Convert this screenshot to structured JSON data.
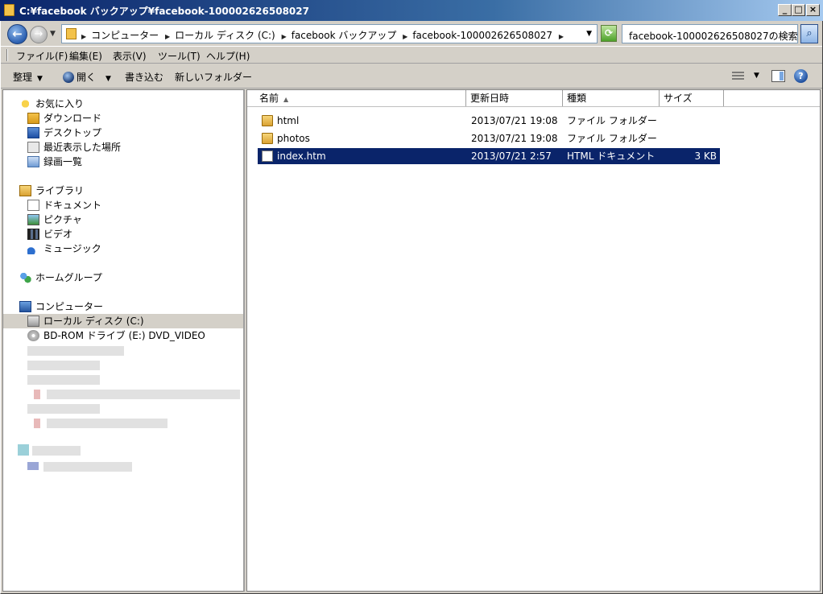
{
  "window": {
    "title": "C:¥facebook バックアップ¥facebook-100002626508027",
    "controls": [
      "_",
      "□",
      "×"
    ]
  },
  "nav": {
    "back_icon": "back-arrow-icon",
    "forward_icon": "forward-arrow-icon",
    "breadcrumbs": [
      "コンピューター",
      "ローカル ディスク (C:)",
      "facebook バックアップ",
      "facebook-100002626508027"
    ],
    "search_placeholder": "facebook-100002626508027の検索"
  },
  "menu": [
    "ファイル(F)",
    "編集(E)",
    "表示(V)",
    "ツール(T)",
    "ヘルプ(H)"
  ],
  "commands": {
    "organize": "整理",
    "open": "開く",
    "burn": "書き込む",
    "new_folder": "新しいフォルダー"
  },
  "sidebar": {
    "favorites": {
      "label": "お気に入り",
      "items": [
        "ダウンロード",
        "デスクトップ",
        "最近表示した場所",
        "録画一覧"
      ]
    },
    "libraries": {
      "label": "ライブラリ",
      "items": [
        "ドキュメント",
        "ピクチャ",
        "ビデオ",
        "ミュージック"
      ]
    },
    "homegroup": "ホームグループ",
    "computer": {
      "label": "コンピューター",
      "items": [
        "ローカル ディスク (C:)",
        "BD-ROM ドライブ (E:) DVD_VIDEO"
      ]
    }
  },
  "columns": [
    "名前",
    "更新日時",
    "種類",
    "サイズ"
  ],
  "files": [
    {
      "name": "html",
      "date": "2013/07/21 19:08",
      "type": "ファイル フォルダー",
      "size": "",
      "icon": "folder-icon"
    },
    {
      "name": "photos",
      "date": "2013/07/21 19:08",
      "type": "ファイル フォルダー",
      "size": "",
      "icon": "folder-icon"
    },
    {
      "name": "index.htm",
      "date": "2013/07/21 2:57",
      "type": "HTML ドキュメント",
      "size": "3 KB",
      "icon": "html-file-icon"
    }
  ],
  "colors": {
    "selection": "#0a246a",
    "title_bar": "#0a246a",
    "chrome": "#d4d0c8"
  }
}
